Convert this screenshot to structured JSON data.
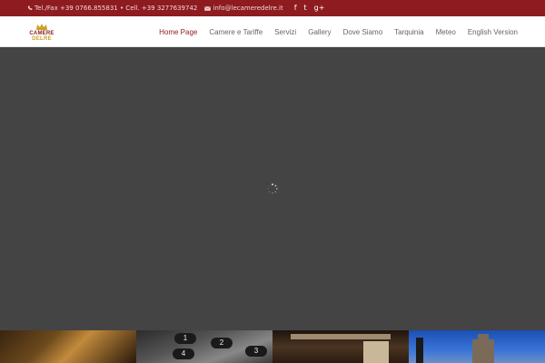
{
  "topbar": {
    "phone_text": "Tel./Fax +39 0766.855831 • Cell. +39 3277639742",
    "email_text": "info@lecameredelre.it",
    "social": [
      "f",
      "t",
      "g+"
    ]
  },
  "logo": {
    "line1": "CAMERE",
    "line2": "DELRE"
  },
  "nav": {
    "items": [
      {
        "label": "Home Page"
      },
      {
        "label": "Camere e Tariffe"
      },
      {
        "label": "Servizi"
      },
      {
        "label": "Gallery"
      },
      {
        "label": "Dove Siamo"
      },
      {
        "label": "Tarquinia"
      },
      {
        "label": "Meteo"
      },
      {
        "label": "English Version"
      }
    ]
  },
  "thumbs": {
    "keypad_keys": [
      "1",
      "2",
      "4",
      "3"
    ]
  },
  "colors": {
    "brand": "#8e1b1f",
    "gold": "#c9a227",
    "hero_bg": "#444444"
  }
}
